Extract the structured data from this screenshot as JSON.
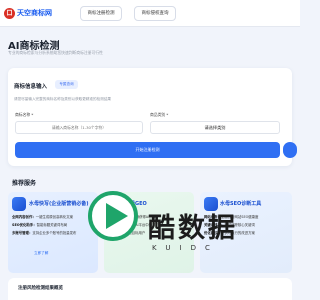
{
  "nav": {
    "logo_mark": "口",
    "logo_text": "天空商标网",
    "buttons": [
      "商标注册检测",
      "商标侵权查询"
    ]
  },
  "page": {
    "title": "AI商标检测",
    "subtitle": "专业的商标检索与分析系统助您快速判断商标注册可行性"
  },
  "form": {
    "title": "商标信息输入",
    "badge": "专属查询",
    "description": "请您尽量输入完整的商标名称及类别以获取更精准的检测结果",
    "name_label": "商标名称 *",
    "name_placeholder": "请输入商标名称（1-30个字符）",
    "category_label": "商品类别 *",
    "category_value": "请选择类别",
    "submit_label": "开始注册检测"
  },
  "services": {
    "section_title": "推荐服务",
    "cards": [
      {
        "title": "水母快写(企业版营销必备)",
        "lines": [
          [
            "全网内容创作：",
            "一键生成原创高转化文案"
          ],
          [
            "SEO优化助手：",
            "智能标题关键词布局"
          ],
          [
            "多账号管理：",
            "支持企业多个账号的批量发布"
          ]
        ],
        "link": "立即了解"
      },
      {
        "title": "水母GEO",
        "lines": [
          [
            "AI搜索优化：",
            "让品牌获得AI推荐"
          ],
          [
            "品牌曝光：",
            "提升在AI平台中的可见度"
          ],
          [
            "获客：",
            "精准触达目标用户"
          ]
        ],
        "link": "立即了解"
      },
      {
        "title": "水母SEO诊断工具",
        "lines": [
          [
            "网站诊断：",
            "全面分析网站SEO健康度"
          ],
          [
            "关键词排名：",
            "实时追踪核心关键词"
          ],
          [
            "优化建议：",
            "提供可执行的改进方案"
          ]
        ],
        "link": "立即了解"
      }
    ]
  },
  "watermark": {
    "text": "酷数据",
    "sub": "KUIDC"
  },
  "bottom": {
    "title": "注册风险检测结果概览"
  },
  "colors": {
    "accent": "#2f6ff3",
    "page_bg": "#f1f4fb",
    "logo_red": "#d93025",
    "watermark_green": "#1fa56a"
  }
}
